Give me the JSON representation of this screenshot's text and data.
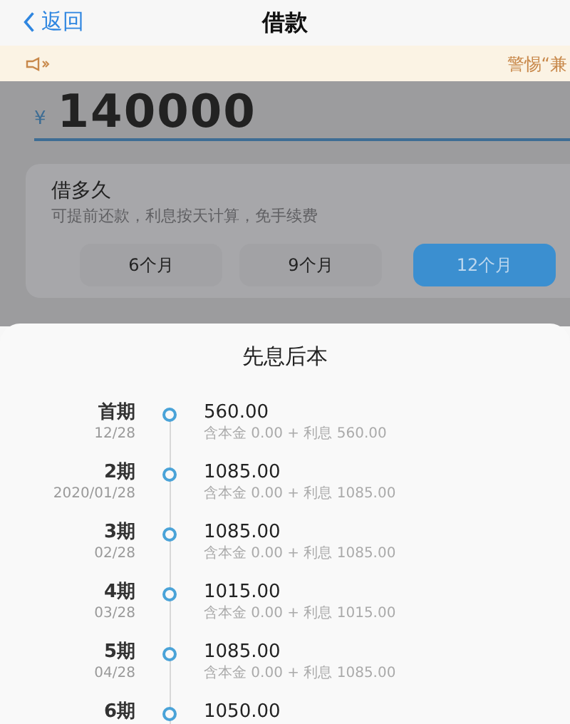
{
  "nav": {
    "back": "返回",
    "title": "借款"
  },
  "notice": {
    "text": "警惕“兼"
  },
  "amount": {
    "currency": "¥",
    "value": "140000"
  },
  "term": {
    "title": "借多久",
    "subtitle": "可提前还款，利息按天计算，免手续费",
    "tabs": [
      {
        "label": "6个月",
        "selected": false
      },
      {
        "label": "9个月",
        "selected": false
      },
      {
        "label": "12个月",
        "selected": true
      }
    ]
  },
  "sheet": {
    "title": "先息后本",
    "rows": [
      {
        "period": "首期",
        "date": "12/28",
        "amount": "560.00",
        "detail": "含本金 0.00 + 利息 560.00"
      },
      {
        "period": "2期",
        "date": "2020/01/28",
        "amount": "1085.00",
        "detail": "含本金 0.00 + 利息 1085.00"
      },
      {
        "period": "3期",
        "date": "02/28",
        "amount": "1085.00",
        "detail": "含本金 0.00 + 利息 1085.00"
      },
      {
        "period": "4期",
        "date": "03/28",
        "amount": "1015.00",
        "detail": "含本金 0.00 + 利息 1015.00"
      },
      {
        "period": "5期",
        "date": "04/28",
        "amount": "1085.00",
        "detail": "含本金 0.00 + 利息 1085.00"
      },
      {
        "period": "6期",
        "amount": "1050.00"
      }
    ]
  }
}
